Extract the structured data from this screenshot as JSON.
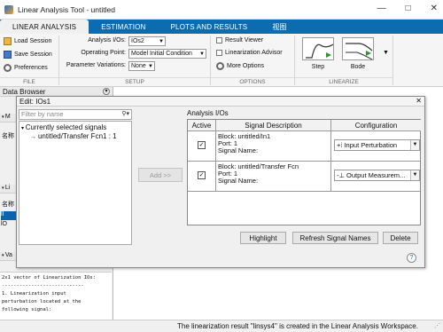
{
  "window": {
    "title": "Linear Analysis Tool - untitled",
    "controls": [
      "—",
      "□",
      "✕"
    ]
  },
  "ribbon_tabs": [
    {
      "label": "LINEAR ANALYSIS"
    },
    {
      "label": "ESTIMATION"
    },
    {
      "label": "PLOTS AND RESULTS"
    },
    {
      "label": "视图"
    }
  ],
  "file_group": {
    "load_session": "Load Session",
    "save_session": "Save Session",
    "preferences": "Preferences",
    "label": "FILE"
  },
  "setup_group": {
    "analysis_ios_label": "Analysis I/Os:",
    "analysis_ios_value": "IOs2",
    "operating_point_label": "Operating Point:",
    "operating_point_value": "Model Initial Condition",
    "parameter_variations_label": "Parameter Variations:",
    "parameter_variations_value": "None",
    "label": "SETUP"
  },
  "options_group": {
    "result_viewer": "Result Viewer",
    "linearization_advisor": "Linearization Advisor",
    "more_options": "More Options",
    "label": "OPTIONS"
  },
  "linearize_group": {
    "step": "Step",
    "bode": "Bode",
    "label": "LINEARIZE"
  },
  "sidebar": {
    "data_browser": "Data Browser",
    "section_m": "M",
    "name_col": "名称",
    "section_li": "Li",
    "name_col2": "名称",
    "item1": "lI",
    "item2": "lO",
    "section_va": "Va",
    "console": [
      "2x1 vector of Linearization IOs:",
      "----------------------------",
      "1. Linearization input",
      "perturbation located at the",
      "following signal:"
    ]
  },
  "dialog": {
    "title": "Edit: IOs1",
    "close": "✕",
    "filter_placeholder": "Filter by name",
    "tree_root": "Currently selected signals",
    "tree_child": "untitled/Transfer Fcn1 : 1",
    "add_button": "Add >>",
    "analysis_ios_title": "Analysis I/Os",
    "columns": [
      "Active",
      "Signal Description",
      "Configuration"
    ],
    "rows": [
      {
        "active": true,
        "block": "Block: untitled/In1",
        "port": "Port: 1",
        "signal": "Signal Name:",
        "config": "Input Perturbation",
        "config_icon": "input-perturbation-icon"
      },
      {
        "active": true,
        "block": "Block: untitled/Transfer Fcn",
        "port": "Port: 1",
        "signal": "Signal Name:",
        "config": "Output Measurem...",
        "config_icon": "output-measurement-icon"
      }
    ],
    "highlight": "Highlight",
    "refresh": "Refresh Signal Names",
    "delete": "Delete",
    "help": "?"
  },
  "status": {
    "message": "The linearization result \"linsys4\" is created in the Linear Analysis Workspace."
  },
  "colors": {
    "ribbon_blue": "#0b6db0",
    "selected_blue": "#0a64ad"
  }
}
